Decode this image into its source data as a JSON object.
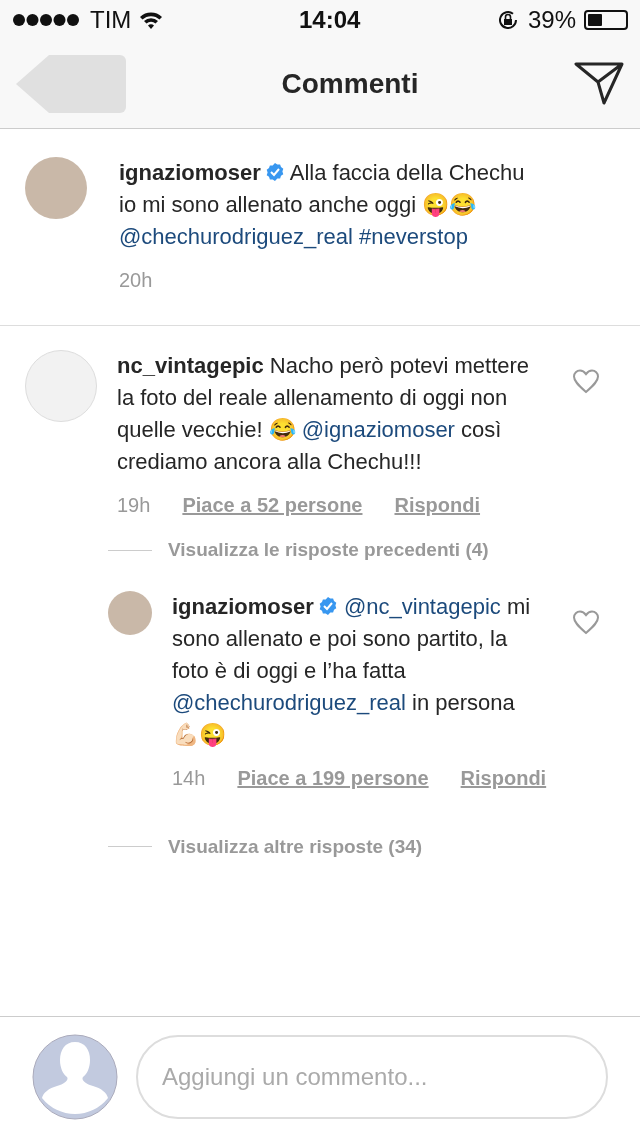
{
  "status_bar": {
    "carrier": "TIM",
    "time": "14:04",
    "battery": "39%"
  },
  "nav": {
    "title": "Commenti"
  },
  "caption": {
    "username": "ignaziomoser",
    "verified": true,
    "time": "20h",
    "parts": [
      {
        "kind": "text",
        "text": "Alla faccia della Chechu io mi sono allenato anche oggi 😜😂 "
      },
      {
        "kind": "mention",
        "text": "@chechurodriguez_real #neverstop"
      }
    ]
  },
  "comments": [
    {
      "username": "nc_vintagepic",
      "verified": false,
      "time": "19h",
      "likes": "Piace a 52 persone",
      "reply": "Rispondi",
      "liked": false,
      "parts": [
        {
          "kind": "text",
          "text": "Nacho però potevi mettere la foto del reale allenamento di oggi non quelle vecchie! 😂 "
        },
        {
          "kind": "mention",
          "text": "@ignaziomoser"
        },
        {
          "kind": "text",
          "text": " così crediamo ancora alla Chechu!!!"
        }
      ],
      "view_replies": "Visualizza le risposte precedenti (4)",
      "replies": [
        {
          "username": "ignaziomoser",
          "verified": true,
          "time": "14h",
          "likes": "Piace a 199 persone",
          "reply": "Rispondi",
          "liked": false,
          "parts": [
            {
              "kind": "mention",
              "text": "@nc_vintagepic"
            },
            {
              "kind": "text",
              "text": " mi sono allenato e poi sono partito, la foto è di oggi e l’ha fatta "
            },
            {
              "kind": "mention",
              "text": "@chechurodriguez_real"
            },
            {
              "kind": "text",
              "text": " in persona 💪🏻😜"
            }
          ]
        }
      ],
      "more_replies": "Visualizza altre risposte (34)"
    }
  ],
  "composer": {
    "placeholder": "Aggiungi un commento..."
  }
}
